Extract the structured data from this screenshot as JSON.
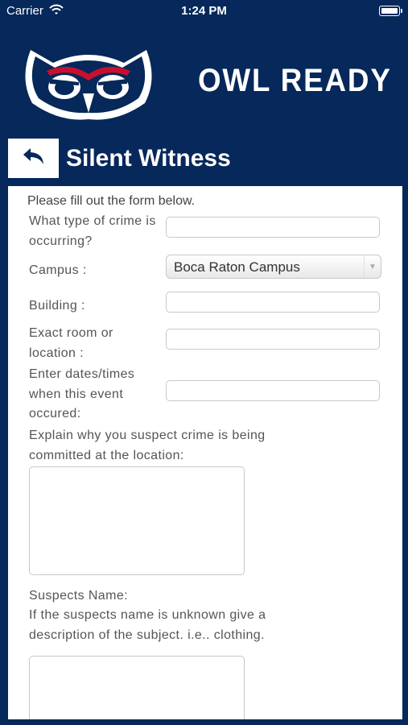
{
  "status_bar": {
    "carrier": "Carrier",
    "time": "1:24 PM"
  },
  "header": {
    "brand": "OWL READY"
  },
  "nav": {
    "title": "Silent Witness"
  },
  "form": {
    "intro": "Please fill out the form below.",
    "crime_type_label": "What type of crime is occurring?",
    "campus_label": "Campus :",
    "campus_value": "Boca Raton Campus",
    "building_label": "Building :",
    "location_label": "Exact room or location :",
    "dates_label": "Enter dates/times when this event occured:",
    "explain_label": "Explain why you suspect crime is being committed at the location:",
    "suspects_label": "Suspects Name:",
    "suspects_hint": "If the suspects name is unknown give a description of the subject. i.e.. clothing."
  },
  "colors": {
    "background": "#06285a",
    "accent_red": "#c8102e",
    "white": "#ffffff"
  },
  "icons": {
    "back": "back-arrow-icon",
    "wifi": "wifi-icon",
    "battery": "battery-icon",
    "logo": "owl-logo"
  }
}
